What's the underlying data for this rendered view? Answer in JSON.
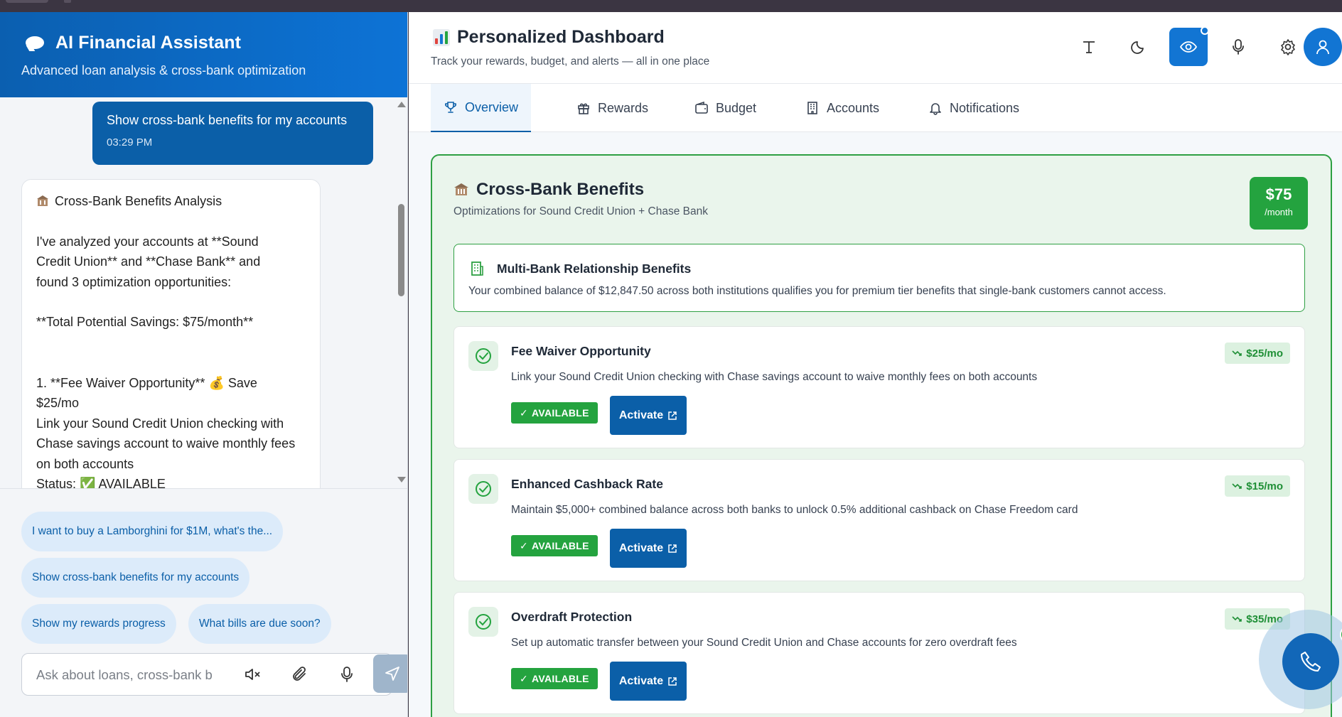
{
  "chat": {
    "title": "AI Financial Assistant",
    "subtitle": "Advanced loan analysis & cross-bank optimization",
    "user_message": {
      "text": "Show cross-bank benefits for my accounts",
      "time": "03:29 PM"
    },
    "ai_message": {
      "title": "Cross-Bank Benefits Analysis",
      "intro_1": "I've analyzed your accounts at **Sound",
      "intro_2": "Credit Union** and **Chase Bank** and",
      "intro_3": "found 3 optimization opportunities:",
      "total": "**Total Potential Savings: $75/month**",
      "item_1": "1. **Fee Waiver Opportunity** 💰 Save",
      "item_2": "$25/mo",
      "item_3": "Link your Sound Credit Union checking with",
      "item_4": "Chase savings account to waive monthly fees",
      "item_5": "on both accounts",
      "status": "Status: ✅ AVAILABLE"
    },
    "suggestions": [
      "I want to buy a Lamborghini for $1M, what's the...",
      "Show cross-bank benefits for my accounts",
      "Show my rewards progress",
      "What bills are due soon?"
    ],
    "input_placeholder": "Ask about loans, cross-bank b"
  },
  "dashboard": {
    "title": "Personalized Dashboard",
    "subtitle": "Track your rewards, budget, and alerts — all in one place",
    "tabs": [
      "Overview",
      "Rewards",
      "Budget",
      "Accounts",
      "Notifications"
    ],
    "active_tab": "Overview",
    "card": {
      "title": "Cross-Bank Benefits",
      "subtitle": "Optimizations for Sound Credit Union + Chase Bank",
      "total_amount": "$75",
      "total_period": "/month",
      "multi_title": "Multi-Bank Relationship Benefits",
      "multi_text": "Your combined balance of $12,847.50 across both institutions qualifies you for premium tier benefits that single-bank customers cannot access.",
      "opportunities": [
        {
          "title": "Fee Waiver Opportunity",
          "text": "Link your Sound Credit Union checking with Chase savings account to waive monthly fees on both accounts",
          "saving": "$25/mo",
          "status": "AVAILABLE",
          "action": "Activate"
        },
        {
          "title": "Enhanced Cashback Rate",
          "text": "Maintain $5,000+ combined balance across both banks to unlock 0.5% additional cashback on Chase Freedom card",
          "saving": "$15/mo",
          "status": "AVAILABLE",
          "action": "Activate"
        },
        {
          "title": "Overdraft Protection",
          "text": "Set up automatic transfer between your Sound Credit Union and Chase accounts for zero overdraft fees",
          "saving": "$35/mo",
          "status": "AVAILABLE",
          "action": "Activate"
        }
      ]
    }
  },
  "colors": {
    "primary": "#0b5fa8",
    "accent_blue": "#1275d3",
    "success": "#24a33f",
    "success_bg": "#eaf5ec"
  }
}
